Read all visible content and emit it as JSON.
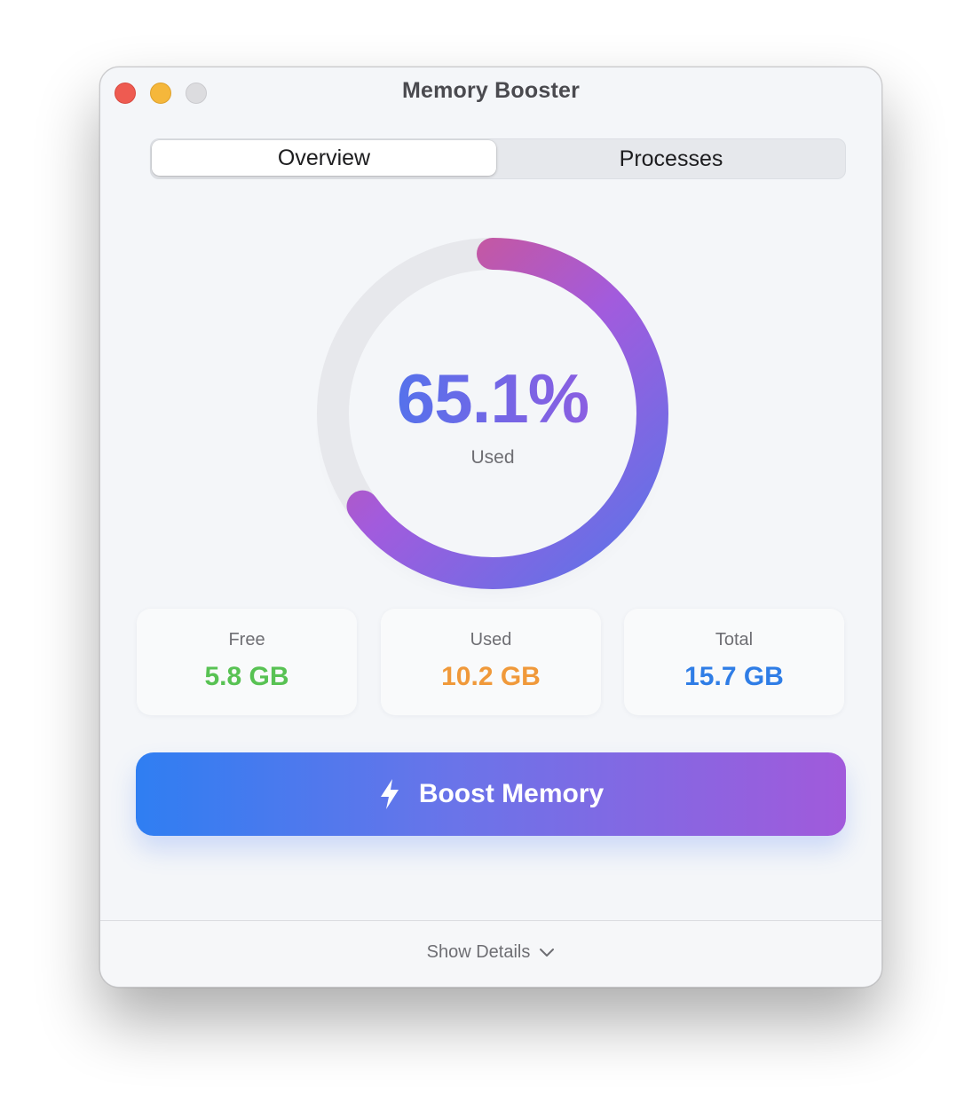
{
  "window": {
    "title": "Memory Booster",
    "controls": [
      "close",
      "minimize",
      "zoom"
    ]
  },
  "tabs": [
    {
      "label": "Overview",
      "selected": true
    },
    {
      "label": "Processes",
      "selected": false
    }
  ],
  "gauge": {
    "value_text": "65.1%",
    "label": "Used",
    "fraction": 0.651,
    "gradient": [
      "#5b74e8",
      "#a25bdd",
      "#d9557f"
    ]
  },
  "stats": [
    {
      "label": "Free",
      "value": "5.8 GB",
      "color": "#58c253"
    },
    {
      "label": "Used",
      "value": "10.2 GB",
      "color": "#f0993a"
    },
    {
      "label": "Total",
      "value": "15.7 GB",
      "color": "#2f7de6"
    }
  ],
  "action": {
    "label": "Boost Memory",
    "icon": "bolt-icon"
  },
  "footer": {
    "label": "Show Details",
    "icon": "chevron-down-icon"
  }
}
